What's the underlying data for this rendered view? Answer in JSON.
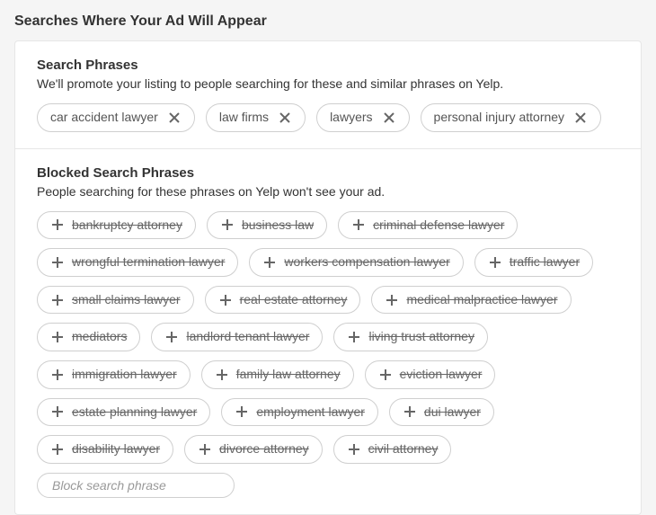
{
  "page": {
    "title": "Searches Where Your Ad Will Appear"
  },
  "search_phrases": {
    "title": "Search Phrases",
    "desc": "We'll promote your listing to people searching for these and similar phrases on Yelp.",
    "items": [
      "car accident lawyer",
      "law firms",
      "lawyers",
      "personal injury attorney"
    ]
  },
  "blocked_phrases": {
    "title": "Blocked Search Phrases",
    "desc": "People searching for these phrases on Yelp won't see your ad.",
    "items": [
      "bankruptcy attorney",
      "business law",
      "criminal defense lawyer",
      "wrongful termination lawyer",
      "workers compensation lawyer",
      "traffic lawyer",
      "small claims lawyer",
      "real estate attorney",
      "medical malpractice lawyer",
      "mediators",
      "landlord tenant lawyer",
      "living trust attorney",
      "immigration lawyer",
      "family law attorney",
      "eviction lawyer",
      "estate planning lawyer",
      "employment lawyer",
      "dui lawyer",
      "disability lawyer",
      "divorce attorney",
      "civil attorney"
    ],
    "input_placeholder": "Block search phrase"
  }
}
